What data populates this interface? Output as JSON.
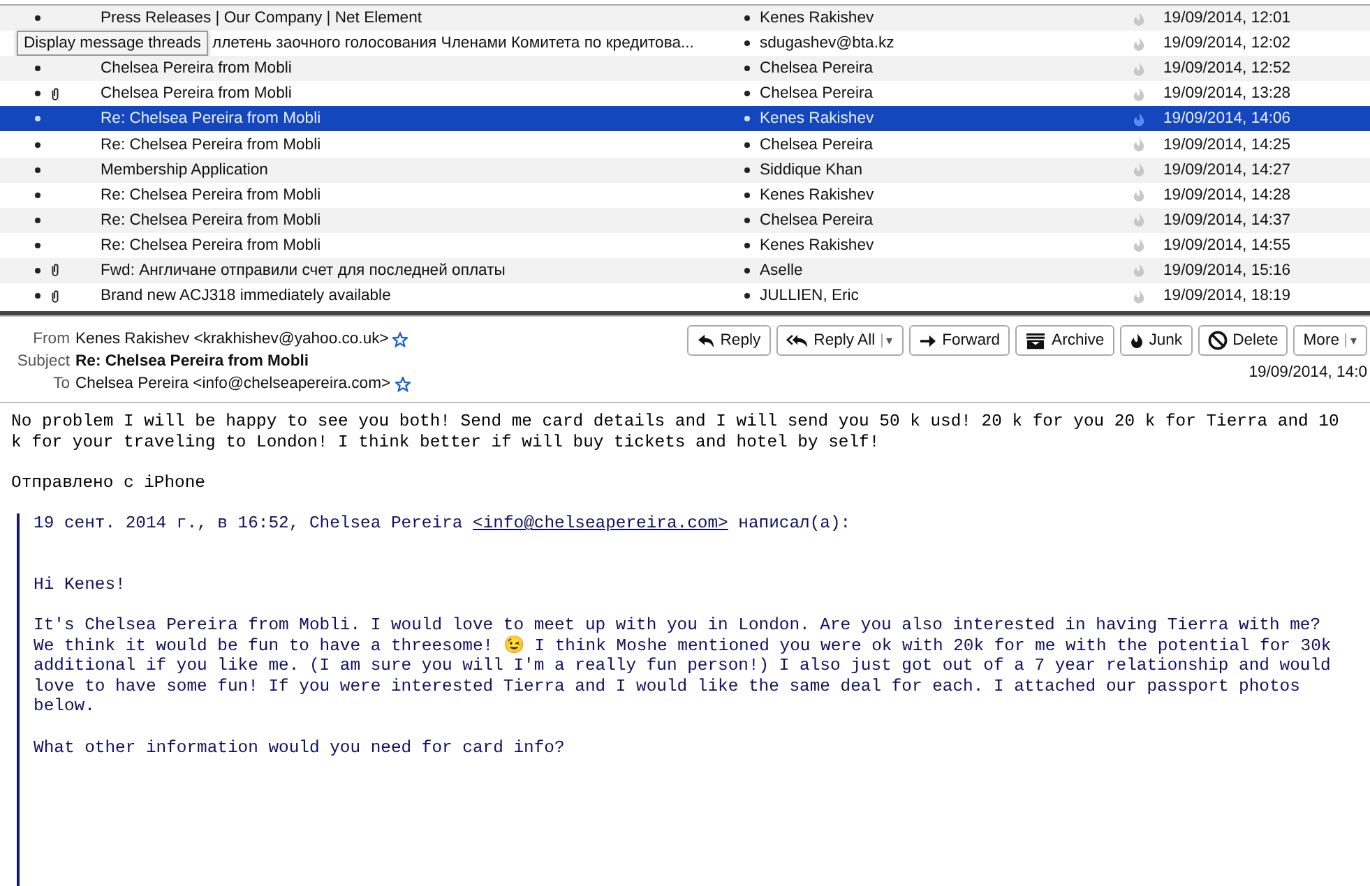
{
  "tooltip": "Display message threads",
  "messages": [
    {
      "subject": "Press Releases | Our Company | Net Element",
      "sender": "Kenes Rakishev",
      "date": "19/09/2014, 12:01",
      "attachment": false,
      "selected": false,
      "covered_by_tooltip": false
    },
    {
      "subject": "ллетень заочного голосования Членами Комитета по кредитова...",
      "sender": "sdugashev@bta.kz",
      "date": "19/09/2014, 12:02",
      "attachment": false,
      "selected": false,
      "covered_by_tooltip": true
    },
    {
      "subject": "Chelsea Pereira from Mobli",
      "sender": "Chelsea Pereira",
      "date": "19/09/2014, 12:52",
      "attachment": false,
      "selected": false,
      "covered_by_tooltip": false
    },
    {
      "subject": "Chelsea Pereira from Mobli",
      "sender": "Chelsea Pereira",
      "date": "19/09/2014, 13:28",
      "attachment": true,
      "selected": false,
      "covered_by_tooltip": false
    },
    {
      "subject": "Re: Chelsea Pereira from Mobli",
      "sender": "Kenes Rakishev",
      "date": "19/09/2014, 14:06",
      "attachment": false,
      "selected": true,
      "covered_by_tooltip": false
    },
    {
      "subject": "Re: Chelsea Pereira from Mobli",
      "sender": "Chelsea Pereira",
      "date": "19/09/2014, 14:25",
      "attachment": false,
      "selected": false,
      "covered_by_tooltip": false
    },
    {
      "subject": "Membership Application",
      "sender": "Siddique Khan",
      "date": "19/09/2014, 14:27",
      "attachment": false,
      "selected": false,
      "covered_by_tooltip": false
    },
    {
      "subject": "Re: Chelsea Pereira from Mobli",
      "sender": "Kenes Rakishev",
      "date": "19/09/2014, 14:28",
      "attachment": false,
      "selected": false,
      "covered_by_tooltip": false
    },
    {
      "subject": "Re: Chelsea Pereira from Mobli",
      "sender": "Chelsea Pereira",
      "date": "19/09/2014, 14:37",
      "attachment": false,
      "selected": false,
      "covered_by_tooltip": false
    },
    {
      "subject": "Re: Chelsea Pereira from Mobli",
      "sender": "Kenes Rakishev",
      "date": "19/09/2014, 14:55",
      "attachment": false,
      "selected": false,
      "covered_by_tooltip": false
    },
    {
      "subject": "Fwd: Англичане отправили счет для последней оплаты",
      "sender": "Aselle",
      "date": "19/09/2014, 15:16",
      "attachment": true,
      "selected": false,
      "covered_by_tooltip": false
    },
    {
      "subject": "Brand new ACJ318 immediately available",
      "sender": "JULLIEN, Eric",
      "date": "19/09/2014, 18:19",
      "attachment": true,
      "selected": false,
      "covered_by_tooltip": false
    }
  ],
  "header": {
    "from_label": "From",
    "from": "Kenes Rakishev <krakhishev@yahoo.co.uk>",
    "subject_label": "Subject",
    "subject": "Re: Chelsea Pereira from Mobli",
    "to_label": "To",
    "to": "Chelsea Pereira <info@chelseapereira.com>",
    "date": "19/09/2014, 14:0"
  },
  "buttons": [
    {
      "label": "Reply",
      "kind": "reply"
    },
    {
      "label": "Reply All",
      "kind": "reply_all",
      "caret": "▾"
    },
    {
      "label": "Forward",
      "kind": "forward"
    },
    {
      "label": "Archive",
      "kind": "archive"
    },
    {
      "label": "Junk",
      "kind": "junk"
    },
    {
      "label": "Delete",
      "kind": "delete"
    },
    {
      "label": "More",
      "kind": "more",
      "caret": "▾"
    }
  ],
  "body": {
    "paragraphs": [
      "No problem I will be happy to see you both! Send me card details and I will send you 50 k usd! 20 k for you 20 k for Tierra and 10 k for your traveling to London! I think better if will buy tickets and hotel by self!",
      "Отправлено с iPhone"
    ],
    "quote": {
      "attribution_before": "19 сент. 2014 г., в 16:52, Chelsea Pereira ",
      "link": "<info@chelseapereira.com>",
      "attribution_after": " написал(а):",
      "paragraphs": [
        "Hi Kenes!",
        "It's Chelsea Pereira from Mobli. I would love to meet up with you in London. Are you also interested in having Tierra with me? We think it would be fun to have a threesome! 😉 I think Moshe mentioned you were ok with 20k for me with the potential for 30k additional if you like me. (I am sure you will I'm a really fun person!) I also just got out of a 7 year relationship and would love to have some fun! If you were interested Tierra and I would like the same deal for each. I attached our passport photos below.",
        "What other information would you need for card info?"
      ]
    }
  }
}
